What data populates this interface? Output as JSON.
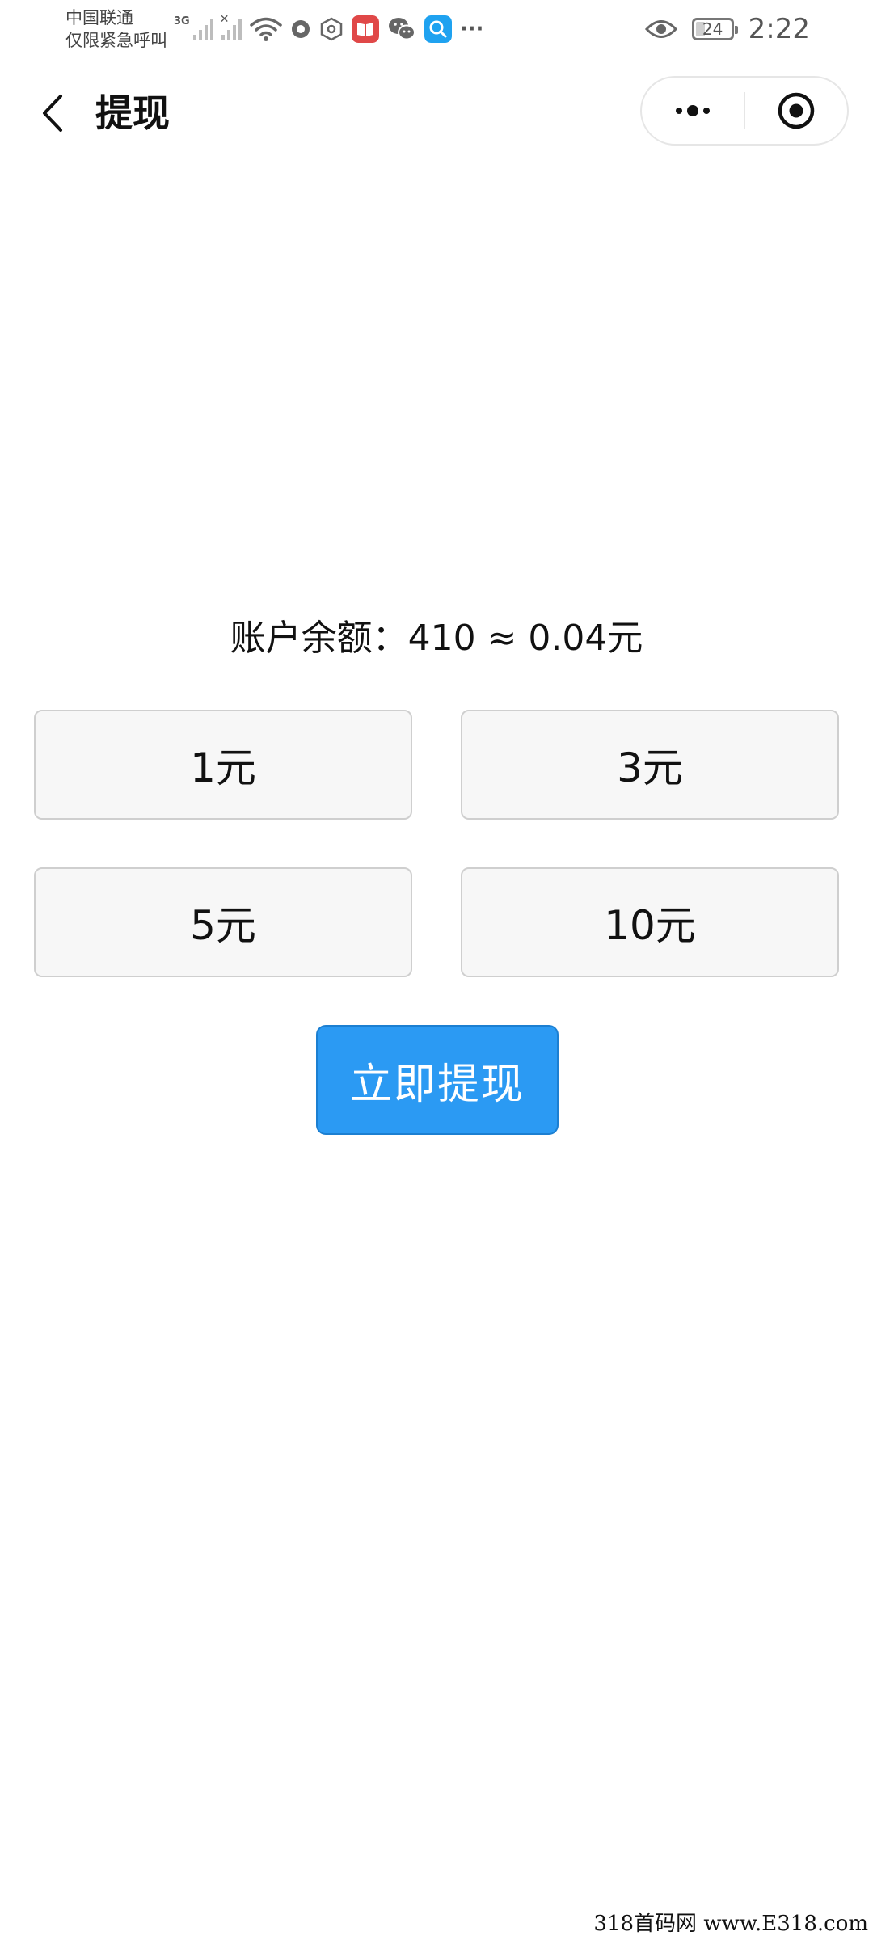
{
  "status_bar": {
    "carrier_line1": "中国联通",
    "carrier_line2": "仅限紧急呼叫",
    "network_type": "3G",
    "more_notifications": "···",
    "battery_level": "24",
    "time": "2:22",
    "icons": [
      "signal-icon",
      "no-signal-icon",
      "wifi-icon",
      "record-icon",
      "hexagon-icon",
      "reader-app-icon",
      "wechat-icon",
      "search-app-icon",
      "eye-icon",
      "battery-icon"
    ],
    "colors": {
      "reader_app": "#e04848",
      "search_app": "#1fa2f0"
    }
  },
  "nav": {
    "title": "提现"
  },
  "main": {
    "balance_text": "账户余额：410 ≈ 0.04元",
    "amounts": [
      {
        "label": "1元"
      },
      {
        "label": "3元"
      },
      {
        "label": "5元"
      },
      {
        "label": "10元"
      }
    ],
    "withdraw_button": "立即提现",
    "withdraw_color": "#2b9af3"
  },
  "watermark": "318首码网 www.E318.com"
}
